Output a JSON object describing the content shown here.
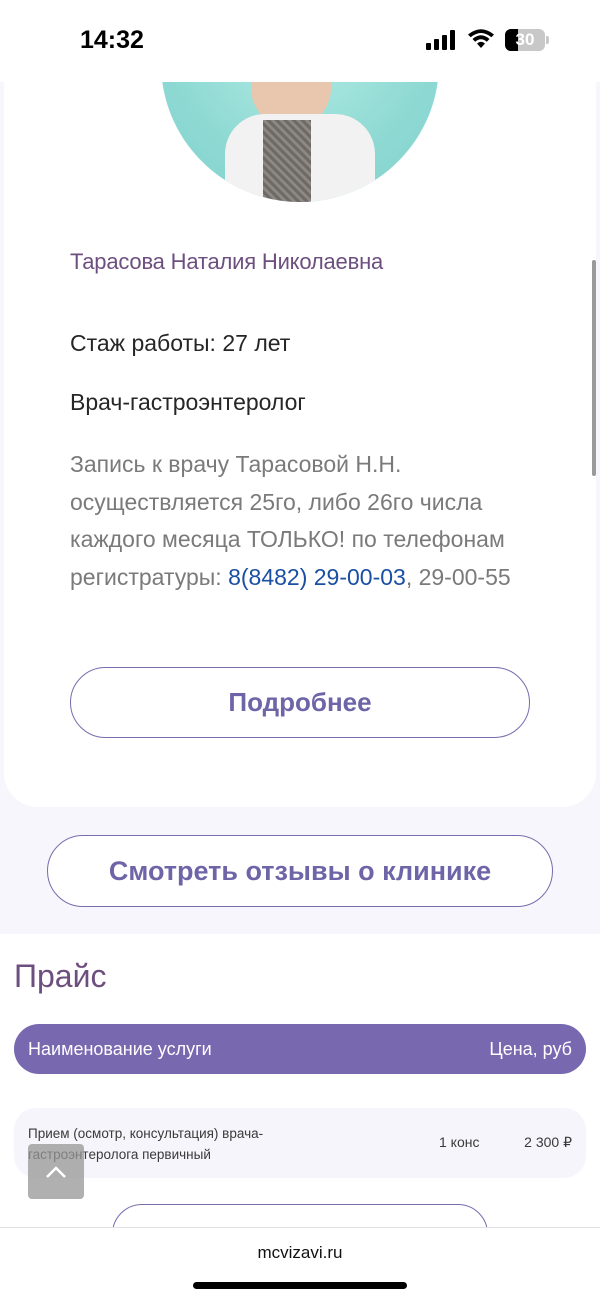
{
  "status_bar": {
    "time": "14:32",
    "battery": "30"
  },
  "doctor": {
    "name": "Тарасова Наталия Николаевна",
    "experience": "Стаж работы: 27 лет",
    "specialty": "Врач-гастроэнтеролог",
    "note_text": "Запись к врачу Тарасовой Н.Н. осуществляется 25го, либо 26го числа каждого месяца ТОЛЬКО! по телефонам регистратуры: ",
    "note_phone": "8(8482) 29-00-03",
    "note_after": ", 29-00-55",
    "more_button": "Подробнее"
  },
  "reviews_button": "Смотреть отзывы о клинике",
  "price": {
    "title": "Прайс",
    "header_name": "Наименование услуги",
    "header_price": "Цена, руб",
    "rows": [
      {
        "service": "Прием (осмотр, консультация) врача-гастроэнтеролога первичный",
        "unit": "1 конс",
        "price": "2 300 ₽"
      }
    ]
  },
  "browser": {
    "url": "mcvizavi.ru"
  },
  "icons": {
    "signal": "signal-icon",
    "wifi": "wifi-icon",
    "battery": "battery-icon",
    "scroll_top": "chevron-up-icon"
  },
  "colors": {
    "accent": "#7868b0",
    "name": "#6d4f7f",
    "link": "#1a4fa3"
  }
}
